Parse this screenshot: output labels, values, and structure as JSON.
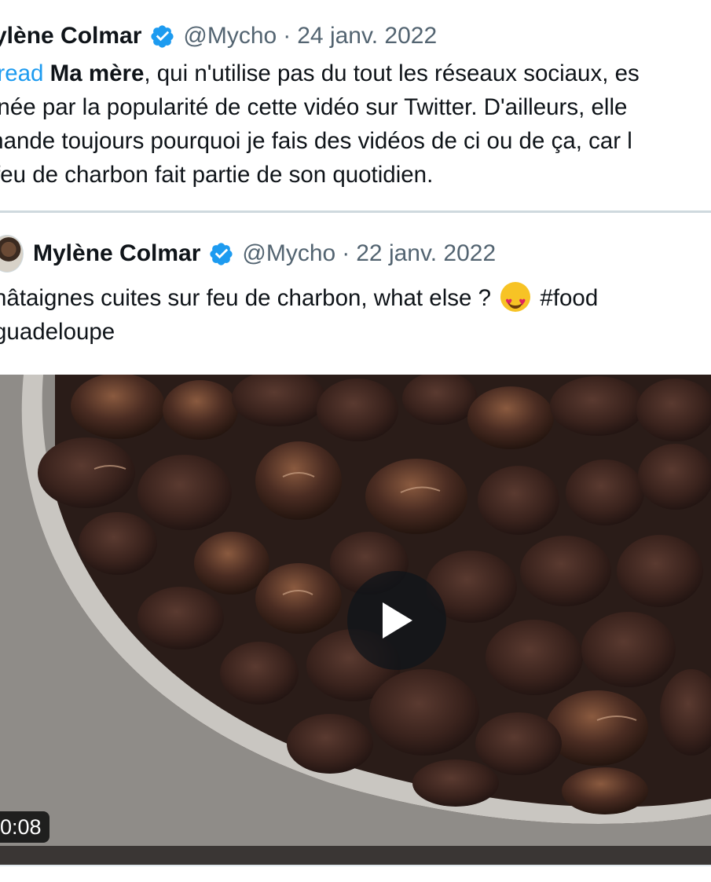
{
  "outer_tweet": {
    "name": "ylène Colmar",
    "handle": "@Mycho",
    "separator": "·",
    "date": "24 janv. 2022",
    "text_lines": [
      {
        "link": "hread",
        "bold": "Ma mère",
        "rest": ", qui n'utilise pas du tout les réseaux sociaux, es"
      },
      "nnée par la popularité de cette vidéo sur Twitter. D'ailleurs, elle",
      "mande toujours pourquoi je fais des vidéos de ci ou de ça, car l",
      "feu de charbon fait partie de son quotidien."
    ]
  },
  "quoted_tweet": {
    "name": "Mylène Colmar",
    "handle": "@Mycho",
    "separator": "·",
    "date": "22 janv. 2022",
    "line1_before": "hâtaignes cuites sur feu de charbon, what else ?",
    "emoji": "heart-eyes-emoji",
    "line1_after": "#food",
    "line2": "guadeloupe",
    "video": {
      "duration": "0:08",
      "play_icon": "play-icon"
    }
  },
  "colors": {
    "link": "#1d9bf0",
    "verified": "#1d9bf0",
    "secondary_text": "#536471",
    "border": "#cfd9de"
  }
}
